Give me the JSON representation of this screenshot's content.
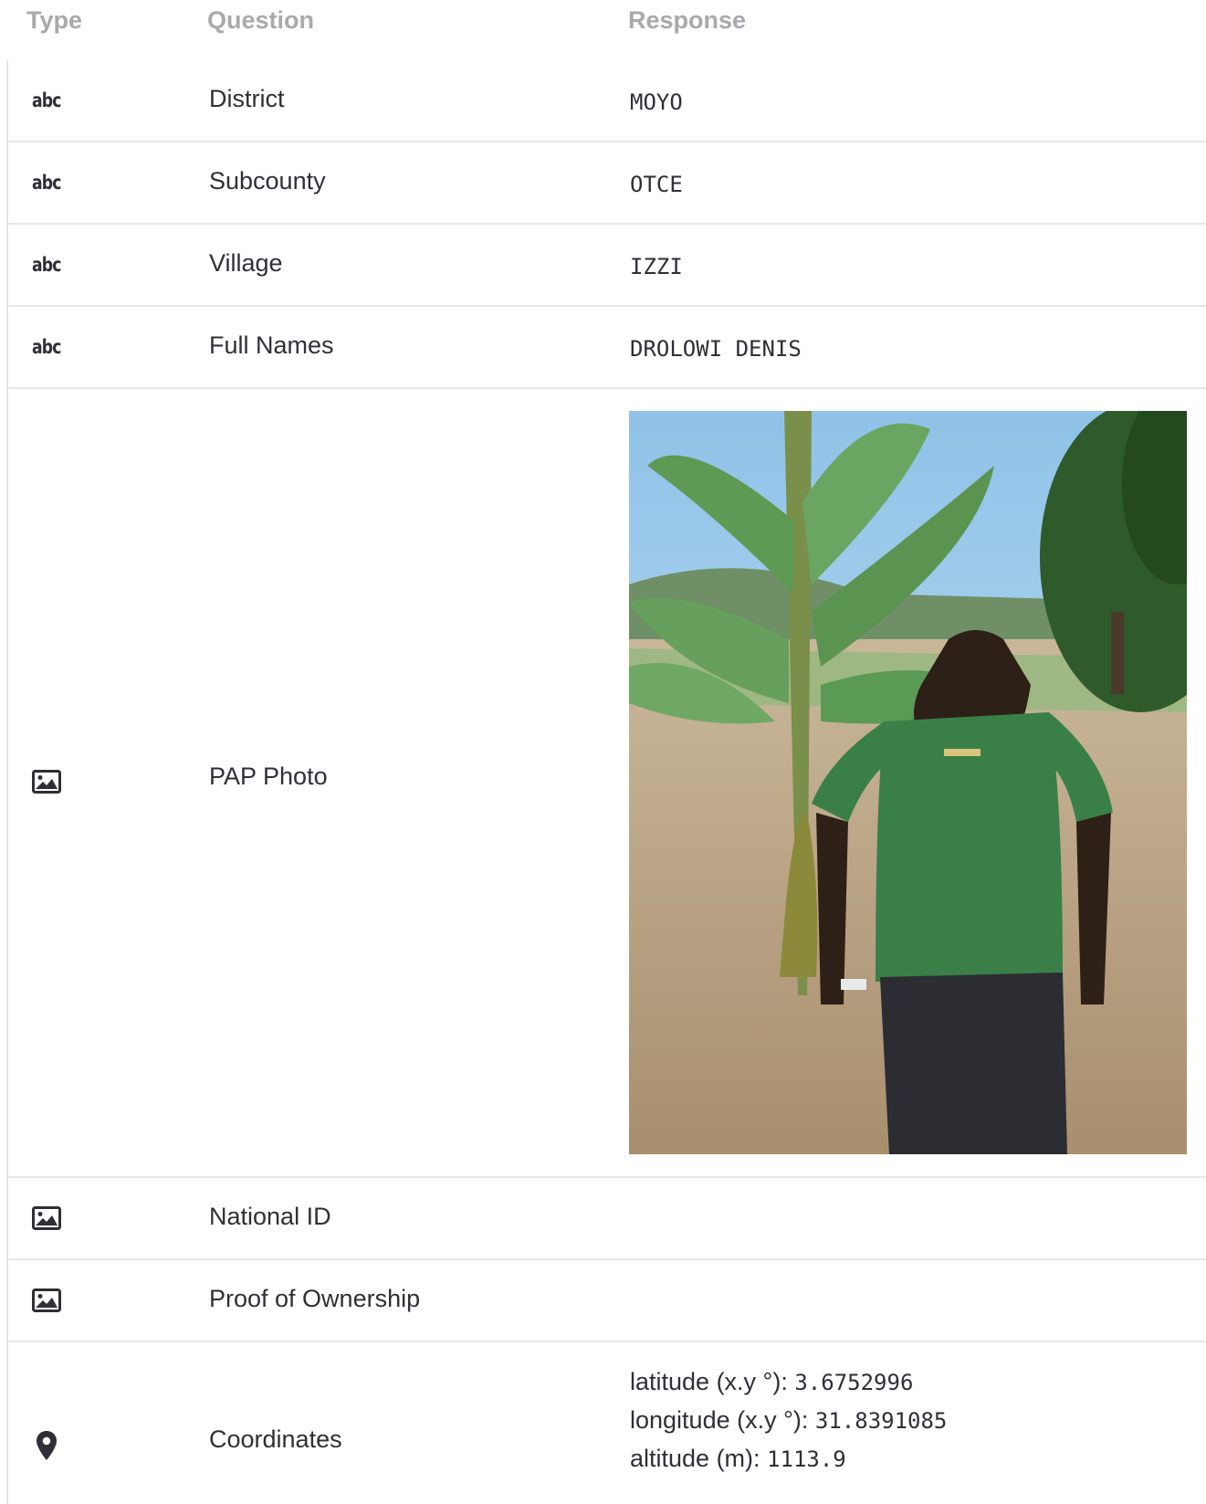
{
  "header": {
    "type": "Type",
    "question": "Question",
    "response": "Response"
  },
  "rows": [
    {
      "type_label": "abc",
      "question": "District",
      "response": "MOYO"
    },
    {
      "type_label": "abc",
      "question": "Subcounty",
      "response": "OTCE"
    },
    {
      "type_label": "abc",
      "question": "Village",
      "response": "IZZI"
    },
    {
      "type_label": "abc",
      "question": "Full Names",
      "response": "DROLOWI DENIS"
    },
    {
      "type_icon": "image-icon",
      "question": "PAP Photo",
      "response_type": "photo"
    },
    {
      "type_icon": "image-icon",
      "question": "National ID",
      "response": ""
    },
    {
      "type_icon": "image-icon",
      "question": "Proof of Ownership",
      "response": ""
    },
    {
      "type_icon": "map-pin-icon",
      "question": "Coordinates",
      "coordinates": {
        "latitude_label": "latitude (x.y °): ",
        "latitude": "3.6752996",
        "longitude_label": "longitude (x.y °): ",
        "longitude": "31.8391085",
        "altitude_label": "altitude (m): ",
        "altitude": "1113.9"
      }
    }
  ],
  "colors": {
    "header_text": "#a9a9ae",
    "body_text": "#2f2f38",
    "divider": "#e6e6e8"
  }
}
